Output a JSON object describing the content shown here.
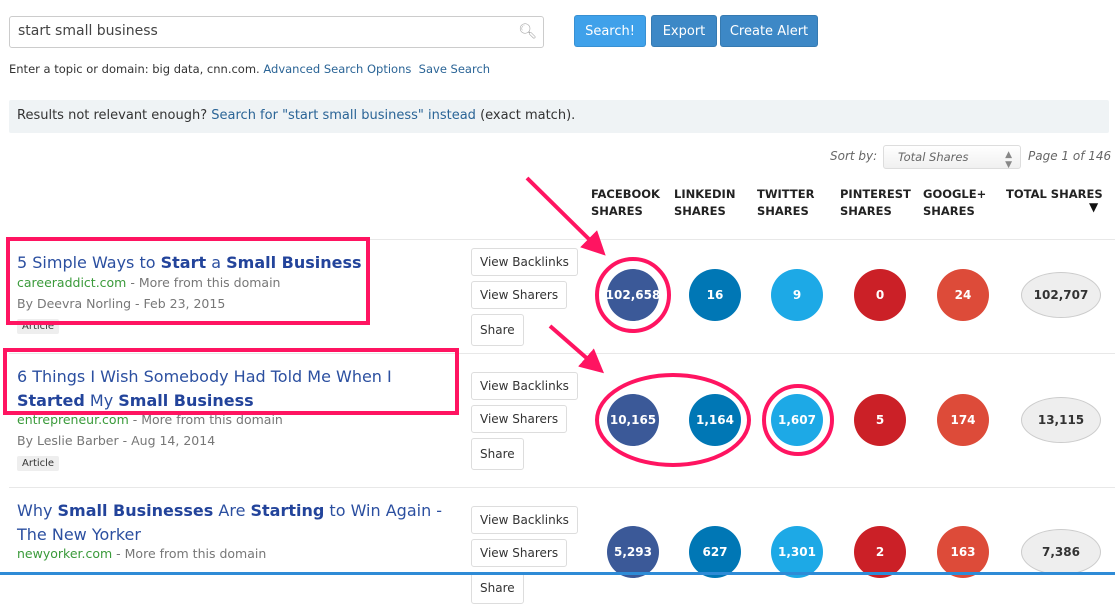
{
  "search": {
    "value": "start small business",
    "icon": "search-icon"
  },
  "buttons": {
    "search": "Search!",
    "export": "Export",
    "create_alert": "Create Alert"
  },
  "colors": {
    "search_btn": "#3fa1ea",
    "export_btn": "#3d88c6",
    "alert_btn": "#3d88c6",
    "facebook": "#3b5998",
    "linkedin": "#0077b5",
    "twitter": "#1da9e6",
    "pinterest": "#cb2027",
    "google": "#dd4b39",
    "annotation": "#ff1461"
  },
  "hint": {
    "text": "Enter a topic or domain: big data, cnn.com.",
    "advanced": "Advanced Search Options",
    "save": "Save Search"
  },
  "notice": {
    "prefix": "Results not relevant enough?",
    "link": "Search for \"start small business\" instead",
    "suffix": "(exact match)."
  },
  "sort": {
    "label": "Sort by:",
    "selected": "Total Shares",
    "page": "Page 1 of 146"
  },
  "columns": [
    {
      "l1": "FACEBOOK",
      "l2": "SHARES"
    },
    {
      "l1": "LINKEDIN",
      "l2": "SHARES"
    },
    {
      "l1": "TWITTER",
      "l2": "SHARES"
    },
    {
      "l1": "PINTEREST",
      "l2": "SHARES"
    },
    {
      "l1": "GOOGLE+",
      "l2": "SHARES"
    },
    {
      "l1": "TOTAL SHARES",
      "l2": ""
    }
  ],
  "action_labels": {
    "backlinks": "View Backlinks",
    "sharers": "View Sharers",
    "share": "Share",
    "more": "More from this domain"
  },
  "results": [
    {
      "title": [
        {
          "t": "5 Simple Ways to ",
          "b": false
        },
        {
          "t": "Start",
          "b": true
        },
        {
          "t": " a ",
          "b": false
        },
        {
          "t": "Small Business",
          "b": true
        }
      ],
      "domain": "careeraddict.com",
      "byline": "By Deevra Norling - Feb 23, 2015",
      "tag": "Article",
      "shares": {
        "facebook": "102,658",
        "linkedin": "16",
        "twitter": "9",
        "pinterest": "0",
        "google": "24",
        "total": "102,707"
      }
    },
    {
      "title": [
        {
          "t": "6 Things I Wish Somebody Had Told Me When I ",
          "b": false
        },
        {
          "t": "Started",
          "b": true
        },
        {
          "t": " My ",
          "b": false
        },
        {
          "t": "Small Business",
          "b": true
        }
      ],
      "domain": "entrepreneur.com",
      "byline": "By Leslie Barber - Aug 14, 2014",
      "tag": "Article",
      "shares": {
        "facebook": "10,165",
        "linkedin": "1,164",
        "twitter": "1,607",
        "pinterest": "5",
        "google": "174",
        "total": "13,115"
      }
    },
    {
      "title": [
        {
          "t": "Why ",
          "b": false
        },
        {
          "t": "Small Businesses",
          "b": true
        },
        {
          "t": " Are ",
          "b": false
        },
        {
          "t": "Starting",
          "b": true
        },
        {
          "t": " to Win Again - The New Yorker",
          "b": false
        }
      ],
      "domain": "newyorker.com",
      "byline": "",
      "tag": "",
      "shares": {
        "facebook": "5,293",
        "linkedin": "627",
        "twitter": "1,301",
        "pinterest": "2",
        "google": "163",
        "total": "7,386"
      }
    }
  ]
}
